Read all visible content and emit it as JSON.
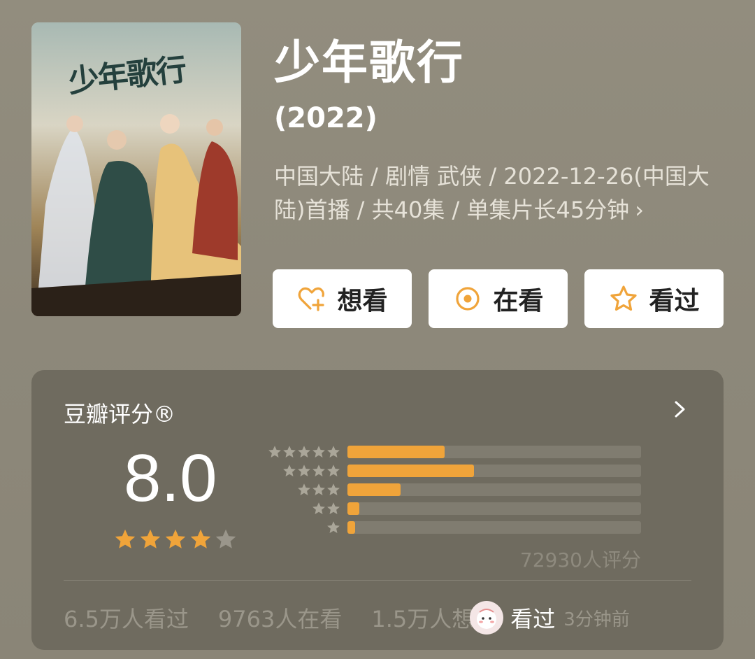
{
  "poster": {
    "alt": "少年歌行 poster",
    "calligraphy": "少年歌行"
  },
  "title": "少年歌行",
  "year": "(2022)",
  "meta": {
    "line": "中国大陆 / 剧情 武侠 / 2022-12-26(中国大陆)首播 / 共40集 / 单集片长45分钟",
    "arrow": "›"
  },
  "actions": [
    {
      "label": "想看",
      "icon": "heart-plus-icon"
    },
    {
      "label": "在看",
      "icon": "circle-dot-icon"
    },
    {
      "label": "看过",
      "icon": "star-outline-icon"
    }
  ],
  "rating": {
    "title": "豆瓣评分®",
    "score": "8.0",
    "stars_filled": 4,
    "stars_total": 5,
    "distribution": [
      {
        "stars": 5,
        "fraction": 0.33
      },
      {
        "stars": 4,
        "fraction": 0.43
      },
      {
        "stars": 3,
        "fraction": 0.18
      },
      {
        "stars": 2,
        "fraction": 0.04
      },
      {
        "stars": 1,
        "fraction": 0.025
      }
    ],
    "raters": "72930人评分"
  },
  "stats": {
    "watched": "6.5万人看过",
    "watching": "9763人在看",
    "want": "1.5万人想",
    "friend_action": "看过",
    "friend_time": "3分钟前"
  },
  "colors": {
    "accent": "#f0a43a",
    "background": "#8f8a7b",
    "card": "#6f6b5f"
  }
}
